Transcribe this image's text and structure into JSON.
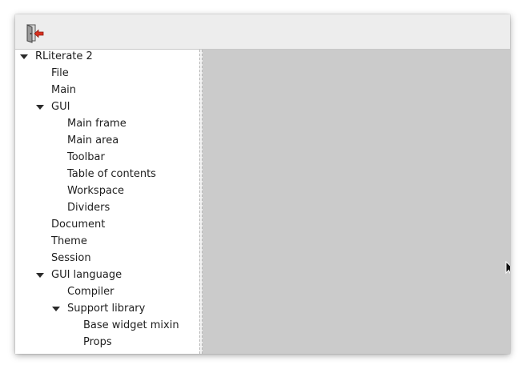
{
  "toolbar": {
    "buttons": [
      {
        "icon": "quit-icon",
        "accent": "#d9301f"
      }
    ]
  },
  "toc": {
    "items": [
      {
        "label": "RLiterate 2",
        "level": 0,
        "expanded": true
      },
      {
        "label": "File",
        "level": 1,
        "expanded": null
      },
      {
        "label": "Main",
        "level": 1,
        "expanded": null
      },
      {
        "label": "GUI",
        "level": 1,
        "expanded": true
      },
      {
        "label": "Main frame",
        "level": 2,
        "expanded": null
      },
      {
        "label": "Main area",
        "level": 2,
        "expanded": null
      },
      {
        "label": "Toolbar",
        "level": 2,
        "expanded": null
      },
      {
        "label": "Table of contents",
        "level": 2,
        "expanded": null
      },
      {
        "label": "Workspace",
        "level": 2,
        "expanded": null
      },
      {
        "label": "Dividers",
        "level": 2,
        "expanded": null
      },
      {
        "label": "Document",
        "level": 1,
        "expanded": null
      },
      {
        "label": "Theme",
        "level": 1,
        "expanded": null
      },
      {
        "label": "Session",
        "level": 1,
        "expanded": null
      },
      {
        "label": "GUI language",
        "level": 1,
        "expanded": true
      },
      {
        "label": "Compiler",
        "level": 2,
        "expanded": null
      },
      {
        "label": "Support library",
        "level": 2,
        "expanded": true
      },
      {
        "label": "Base widget mixin",
        "level": 3,
        "expanded": null
      },
      {
        "label": "Props",
        "level": 3,
        "expanded": null
      }
    ]
  },
  "colors": {
    "workspace": "#cbcbcb",
    "toolbar": "#ededed"
  }
}
